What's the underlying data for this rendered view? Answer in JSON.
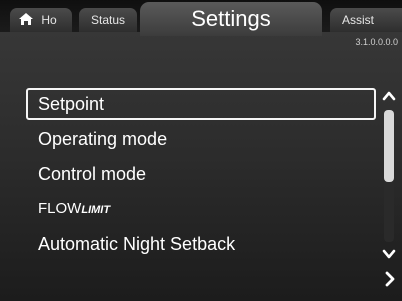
{
  "tabs": {
    "home": "Ho",
    "status": "Status",
    "settings": "Settings",
    "assist": "Assist"
  },
  "version": "3.1.0.0.0.0",
  "menu": {
    "items": [
      {
        "label": "Setpoint",
        "selected": true
      },
      {
        "label": "Operating mode",
        "selected": false
      },
      {
        "label": "Control mode",
        "selected": false
      },
      {
        "label": "FLOW",
        "suffix": "LIMIT",
        "selected": false
      },
      {
        "label": "Automatic Night Setback",
        "selected": false
      }
    ]
  },
  "icons": {
    "home": "home-icon",
    "scroll_up": "chevron-up-icon",
    "scroll_down": "chevron-down-icon",
    "next": "chevron-right-icon"
  },
  "colors": {
    "background": "#2b2b2b",
    "text": "#ffffff",
    "selection_border": "#f5f5f5"
  }
}
